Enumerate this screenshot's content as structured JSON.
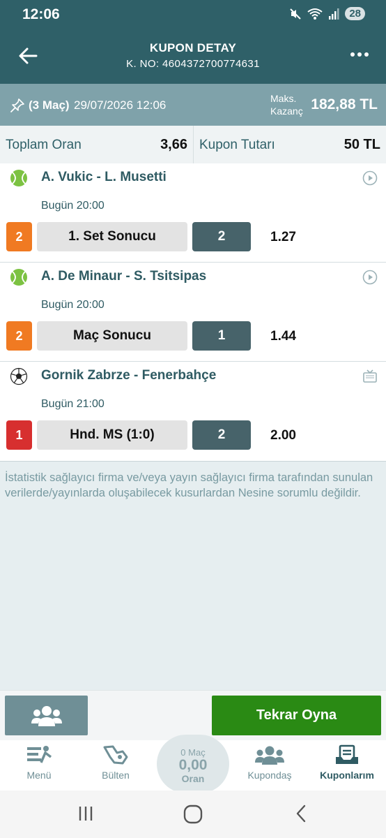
{
  "status_bar": {
    "time": "12:06",
    "battery": "28"
  },
  "header": {
    "title": "KUPON DETAY",
    "coupon_no": "K. NO: 4604372700774631"
  },
  "summary": {
    "match_count": "(3 Maç)",
    "date": "29/07/2026 12:06",
    "max_win_label_1": "Maks.",
    "max_win_label_2": "Kazanç",
    "max_win_value": "182,88 TL"
  },
  "totals": {
    "total_odds_label": "Toplam Oran",
    "total_odds_value": "3,66",
    "coupon_amount_label": "Kupon Tutarı",
    "coupon_amount_value": "50 TL"
  },
  "events": [
    {
      "sport_icon": "tennis-ball-icon",
      "teams": "A. Vukic - L. Musetti",
      "time": "Bugün 20:00",
      "mbs": "2",
      "mbs_color": "#f07a22",
      "market": "1. Set Sonucu",
      "pick": "2",
      "odd": "1.27",
      "action_icon": "play-circle-icon"
    },
    {
      "sport_icon": "tennis-ball-icon",
      "teams": "A. De Minaur - S. Tsitsipas",
      "time": "Bugün 20:00",
      "mbs": "2",
      "mbs_color": "#f07a22",
      "market": "Maç Sonucu",
      "pick": "1",
      "odd": "1.44",
      "action_icon": "play-circle-icon"
    },
    {
      "sport_icon": "soccer-ball-icon",
      "teams": "Gornik Zabrze - Fenerbahçe",
      "time": "Bugün 21:00",
      "mbs": "1",
      "mbs_color": "#d72f2f",
      "market": "Hnd. MS (1:0)",
      "pick": "2",
      "odd": "2.00",
      "action_icon": "tv-icon"
    }
  ],
  "disclaimer": "İstatistik sağlayıcı firma ve/veya yayın sağlayıcı firma tarafından sunulan verilerde/yayınlarda oluşabilecek kusurlardan Nesine sorumlu değildir.",
  "actions": {
    "replay_label": "Tekrar Oyna"
  },
  "bottom_nav": {
    "menu": "Menü",
    "bulletin": "Bülten",
    "center_top": "0 Maç",
    "center_value": "0,00",
    "center_bottom": "Oran",
    "kupondas": "Kupondaş",
    "my_coupons": "Kuponlarım"
  },
  "colors": {
    "header": "#2f6068",
    "summary": "#7fa2aa",
    "replay": "#2a8a14",
    "pick": "#47636a"
  }
}
